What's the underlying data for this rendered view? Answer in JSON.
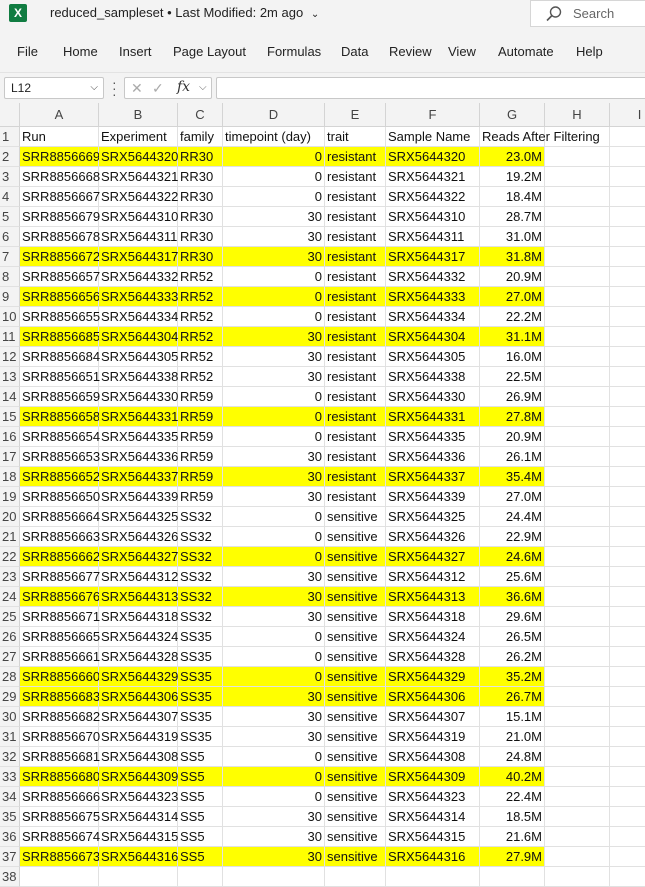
{
  "app": {
    "icon_label": "X",
    "doc_title": "reduced_sampleset",
    "separator": "•",
    "modified": "Last Modified: 2m ago"
  },
  "search": {
    "placeholder": "Search"
  },
  "tabs": [
    "File",
    "Home",
    "Insert",
    "Page Layout",
    "Formulas",
    "Data",
    "Review",
    "View",
    "Automate",
    "Help"
  ],
  "formula_bar": {
    "name_box": "L12",
    "fx": "fx",
    "formula": ""
  },
  "highlight_color": "#ffff00",
  "columns": [
    "A",
    "B",
    "C",
    "D",
    "E",
    "F",
    "G",
    "H",
    "I"
  ],
  "header_row": [
    "Run",
    "Experiment",
    "family",
    "timepoint (day)",
    "trait",
    "Sample Name",
    "Reads After Filtering"
  ],
  "rows": [
    {
      "n": "2",
      "hl": true,
      "v": [
        "SRR8856669",
        "SRX5644320",
        "RR30",
        "0",
        "resistant",
        "SRX5644320",
        "23.0M"
      ]
    },
    {
      "n": "3",
      "hl": false,
      "v": [
        "SRR8856668",
        "SRX5644321",
        "RR30",
        "0",
        "resistant",
        "SRX5644321",
        "19.2M"
      ]
    },
    {
      "n": "4",
      "hl": false,
      "v": [
        "SRR8856667",
        "SRX5644322",
        "RR30",
        "0",
        "resistant",
        "SRX5644322",
        "18.4M"
      ]
    },
    {
      "n": "5",
      "hl": false,
      "v": [
        "SRR8856679",
        "SRX5644310",
        "RR30",
        "30",
        "resistant",
        "SRX5644310",
        "28.7M"
      ]
    },
    {
      "n": "6",
      "hl": false,
      "v": [
        "SRR8856678",
        "SRX5644311",
        "RR30",
        "30",
        "resistant",
        "SRX5644311",
        "31.0M"
      ]
    },
    {
      "n": "7",
      "hl": true,
      "v": [
        "SRR8856672",
        "SRX5644317",
        "RR30",
        "30",
        "resistant",
        "SRX5644317",
        "31.8M"
      ]
    },
    {
      "n": "8",
      "hl": false,
      "v": [
        "SRR8856657",
        "SRX5644332",
        "RR52",
        "0",
        "resistant",
        "SRX5644332",
        "20.9M"
      ]
    },
    {
      "n": "9",
      "hl": true,
      "v": [
        "SRR8856656",
        "SRX5644333",
        "RR52",
        "0",
        "resistant",
        "SRX5644333",
        "27.0M"
      ]
    },
    {
      "n": "10",
      "hl": false,
      "v": [
        "SRR8856655",
        "SRX5644334",
        "RR52",
        "0",
        "resistant",
        "SRX5644334",
        "22.2M"
      ]
    },
    {
      "n": "11",
      "hl": true,
      "v": [
        "SRR8856685",
        "SRX5644304",
        "RR52",
        "30",
        "resistant",
        "SRX5644304",
        "31.1M"
      ]
    },
    {
      "n": "12",
      "hl": false,
      "v": [
        "SRR8856684",
        "SRX5644305",
        "RR52",
        "30",
        "resistant",
        "SRX5644305",
        "16.0M"
      ]
    },
    {
      "n": "13",
      "hl": false,
      "v": [
        "SRR8856651",
        "SRX5644338",
        "RR52",
        "30",
        "resistant",
        "SRX5644338",
        "22.5M"
      ]
    },
    {
      "n": "14",
      "hl": false,
      "v": [
        "SRR8856659",
        "SRX5644330",
        "RR59",
        "0",
        "resistant",
        "SRX5644330",
        "26.9M"
      ]
    },
    {
      "n": "15",
      "hl": true,
      "v": [
        "SRR8856658",
        "SRX5644331",
        "RR59",
        "0",
        "resistant",
        "SRX5644331",
        "27.8M"
      ]
    },
    {
      "n": "16",
      "hl": false,
      "v": [
        "SRR8856654",
        "SRX5644335",
        "RR59",
        "0",
        "resistant",
        "SRX5644335",
        "20.9M"
      ]
    },
    {
      "n": "17",
      "hl": false,
      "v": [
        "SRR8856653",
        "SRX5644336",
        "RR59",
        "30",
        "resistant",
        "SRX5644336",
        "26.1M"
      ]
    },
    {
      "n": "18",
      "hl": true,
      "v": [
        "SRR8856652",
        "SRX5644337",
        "RR59",
        "30",
        "resistant",
        "SRX5644337",
        "35.4M"
      ]
    },
    {
      "n": "19",
      "hl": false,
      "v": [
        "SRR8856650",
        "SRX5644339",
        "RR59",
        "30",
        "resistant",
        "SRX5644339",
        "27.0M"
      ]
    },
    {
      "n": "20",
      "hl": false,
      "v": [
        "SRR8856664",
        "SRX5644325",
        "SS32",
        "0",
        "sensitive",
        "SRX5644325",
        "24.4M"
      ]
    },
    {
      "n": "21",
      "hl": false,
      "v": [
        "SRR8856663",
        "SRX5644326",
        "SS32",
        "0",
        "sensitive",
        "SRX5644326",
        "22.9M"
      ]
    },
    {
      "n": "22",
      "hl": true,
      "v": [
        "SRR8856662",
        "SRX5644327",
        "SS32",
        "0",
        "sensitive",
        "SRX5644327",
        "24.6M"
      ]
    },
    {
      "n": "23",
      "hl": false,
      "v": [
        "SRR8856677",
        "SRX5644312",
        "SS32",
        "30",
        "sensitive",
        "SRX5644312",
        "25.6M"
      ]
    },
    {
      "n": "24",
      "hl": true,
      "v": [
        "SRR8856676",
        "SRX5644313",
        "SS32",
        "30",
        "sensitive",
        "SRX5644313",
        "36.6M"
      ]
    },
    {
      "n": "25",
      "hl": false,
      "v": [
        "SRR8856671",
        "SRX5644318",
        "SS32",
        "30",
        "sensitive",
        "SRX5644318",
        "29.6M"
      ]
    },
    {
      "n": "26",
      "hl": false,
      "v": [
        "SRR8856665",
        "SRX5644324",
        "SS35",
        "0",
        "sensitive",
        "SRX5644324",
        "26.5M"
      ]
    },
    {
      "n": "27",
      "hl": false,
      "v": [
        "SRR8856661",
        "SRX5644328",
        "SS35",
        "0",
        "sensitive",
        "SRX5644328",
        "26.2M"
      ]
    },
    {
      "n": "28",
      "hl": true,
      "v": [
        "SRR8856660",
        "SRX5644329",
        "SS35",
        "0",
        "sensitive",
        "SRX5644329",
        "35.2M"
      ]
    },
    {
      "n": "29",
      "hl": true,
      "v": [
        "SRR8856683",
        "SRX5644306",
        "SS35",
        "30",
        "sensitive",
        "SRX5644306",
        "26.7M"
      ]
    },
    {
      "n": "30",
      "hl": false,
      "v": [
        "SRR8856682",
        "SRX5644307",
        "SS35",
        "30",
        "sensitive",
        "SRX5644307",
        "15.1M"
      ]
    },
    {
      "n": "31",
      "hl": false,
      "v": [
        "SRR8856670",
        "SRX5644319",
        "SS35",
        "30",
        "sensitive",
        "SRX5644319",
        "21.0M"
      ]
    },
    {
      "n": "32",
      "hl": false,
      "v": [
        "SRR8856681",
        "SRX5644308",
        "SS5",
        "0",
        "sensitive",
        "SRX5644308",
        "24.8M"
      ]
    },
    {
      "n": "33",
      "hl": true,
      "v": [
        "SRR8856680",
        "SRX5644309",
        "SS5",
        "0",
        "sensitive",
        "SRX5644309",
        "40.2M"
      ]
    },
    {
      "n": "34",
      "hl": false,
      "v": [
        "SRR8856666",
        "SRX5644323",
        "SS5",
        "0",
        "sensitive",
        "SRX5644323",
        "22.4M"
      ]
    },
    {
      "n": "35",
      "hl": false,
      "v": [
        "SRR8856675",
        "SRX5644314",
        "SS5",
        "30",
        "sensitive",
        "SRX5644314",
        "18.5M"
      ]
    },
    {
      "n": "36",
      "hl": false,
      "v": [
        "SRR8856674",
        "SRX5644315",
        "SS5",
        "30",
        "sensitive",
        "SRX5644315",
        "21.6M"
      ]
    },
    {
      "n": "37",
      "hl": true,
      "v": [
        "SRR8856673",
        "SRX5644316",
        "SS5",
        "30",
        "sensitive",
        "SRX5644316",
        "27.9M"
      ]
    },
    {
      "n": "38",
      "hl": false,
      "v": [
        "",
        "",
        "",
        "",
        "",
        "",
        ""
      ]
    }
  ]
}
